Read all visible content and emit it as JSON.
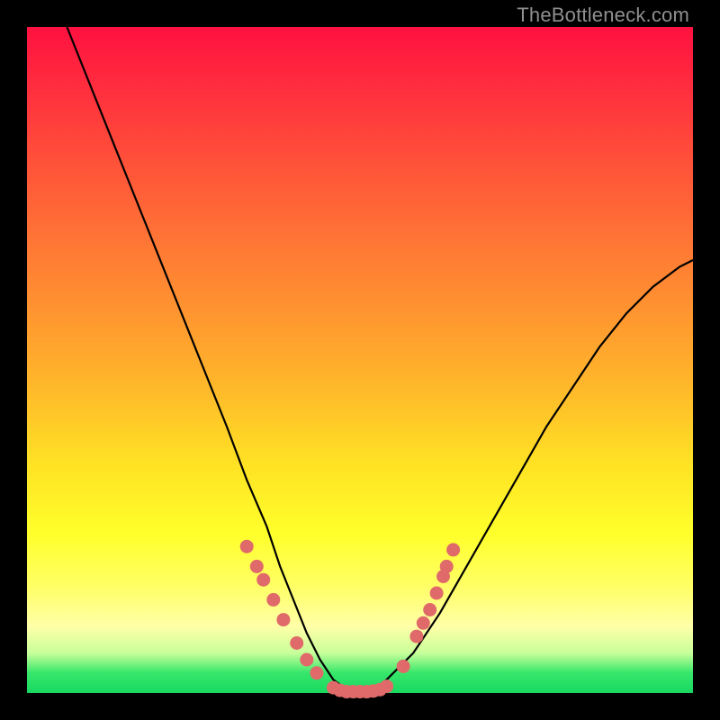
{
  "watermark": "TheBottleneck.com",
  "colors": {
    "curve_stroke": "#000000",
    "marker_fill": "#e06a6a",
    "marker_stroke": "#cc5a5a"
  },
  "chart_data": {
    "type": "line",
    "title": "",
    "xlabel": "",
    "ylabel": "",
    "xlim": [
      0,
      100
    ],
    "ylim": [
      0,
      100
    ],
    "series": [
      {
        "name": "bottleneck-curve",
        "x": [
          6,
          10,
          14,
          18,
          22,
          26,
          30,
          33,
          36,
          38,
          40,
          42,
          44,
          46,
          48,
          50,
          52,
          54,
          58,
          62,
          66,
          70,
          74,
          78,
          82,
          86,
          90,
          94,
          98,
          100
        ],
        "y": [
          100,
          90,
          80,
          70,
          60,
          50,
          40,
          32,
          25,
          19,
          14,
          9,
          5,
          2,
          0.5,
          0,
          0.5,
          2,
          6,
          12,
          19,
          26,
          33,
          40,
          46,
          52,
          57,
          61,
          64,
          65
        ]
      }
    ],
    "markers": [
      {
        "x": 33.0,
        "y": 22.0
      },
      {
        "x": 34.5,
        "y": 19.0
      },
      {
        "x": 35.5,
        "y": 17.0
      },
      {
        "x": 37.0,
        "y": 14.0
      },
      {
        "x": 38.5,
        "y": 11.0
      },
      {
        "x": 40.5,
        "y": 7.5
      },
      {
        "x": 42.0,
        "y": 5.0
      },
      {
        "x": 43.5,
        "y": 3.0
      },
      {
        "x": 46.0,
        "y": 0.8
      },
      {
        "x": 47.0,
        "y": 0.4
      },
      {
        "x": 48.0,
        "y": 0.2
      },
      {
        "x": 49.0,
        "y": 0.2
      },
      {
        "x": 50.0,
        "y": 0.2
      },
      {
        "x": 51.0,
        "y": 0.2
      },
      {
        "x": 52.0,
        "y": 0.3
      },
      {
        "x": 53.0,
        "y": 0.5
      },
      {
        "x": 54.0,
        "y": 1.0
      },
      {
        "x": 56.5,
        "y": 4.0
      },
      {
        "x": 58.5,
        "y": 8.5
      },
      {
        "x": 59.5,
        "y": 10.5
      },
      {
        "x": 60.5,
        "y": 12.5
      },
      {
        "x": 61.5,
        "y": 15.0
      },
      {
        "x": 62.5,
        "y": 17.5
      },
      {
        "x": 63.0,
        "y": 19.0
      },
      {
        "x": 64.0,
        "y": 21.5
      }
    ]
  }
}
